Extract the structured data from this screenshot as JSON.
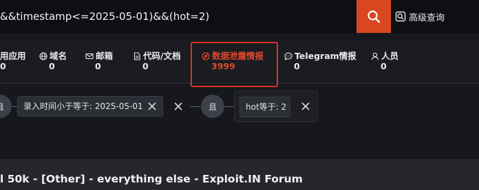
{
  "search": {
    "query": "&&timestamp<=2025-05-01)&&(hot=2)",
    "advanced_label": "高级查询"
  },
  "tabs": [
    {
      "label": "用应用",
      "count": "0"
    },
    {
      "label": "域名",
      "count": "0"
    },
    {
      "label": "邮箱",
      "count": "0"
    },
    {
      "label": "代码/文档",
      "count": "0"
    },
    {
      "label": "数据泄露情报",
      "count": "3999"
    },
    {
      "label": "Telegram情报",
      "count": "0"
    },
    {
      "label": "人员",
      "count": "0"
    }
  ],
  "filters": {
    "and_label": "且",
    "chip1": "录入时间小于等于: 2025-05-01",
    "chip2": "hot等于: 2"
  },
  "result": {
    "title": "l 50k - [Other] - everything else - Exploit.IN Forum"
  },
  "colors": {
    "accent": "#d9461f",
    "active_tab": "#e0482e",
    "highlight_box": "#e23323"
  }
}
